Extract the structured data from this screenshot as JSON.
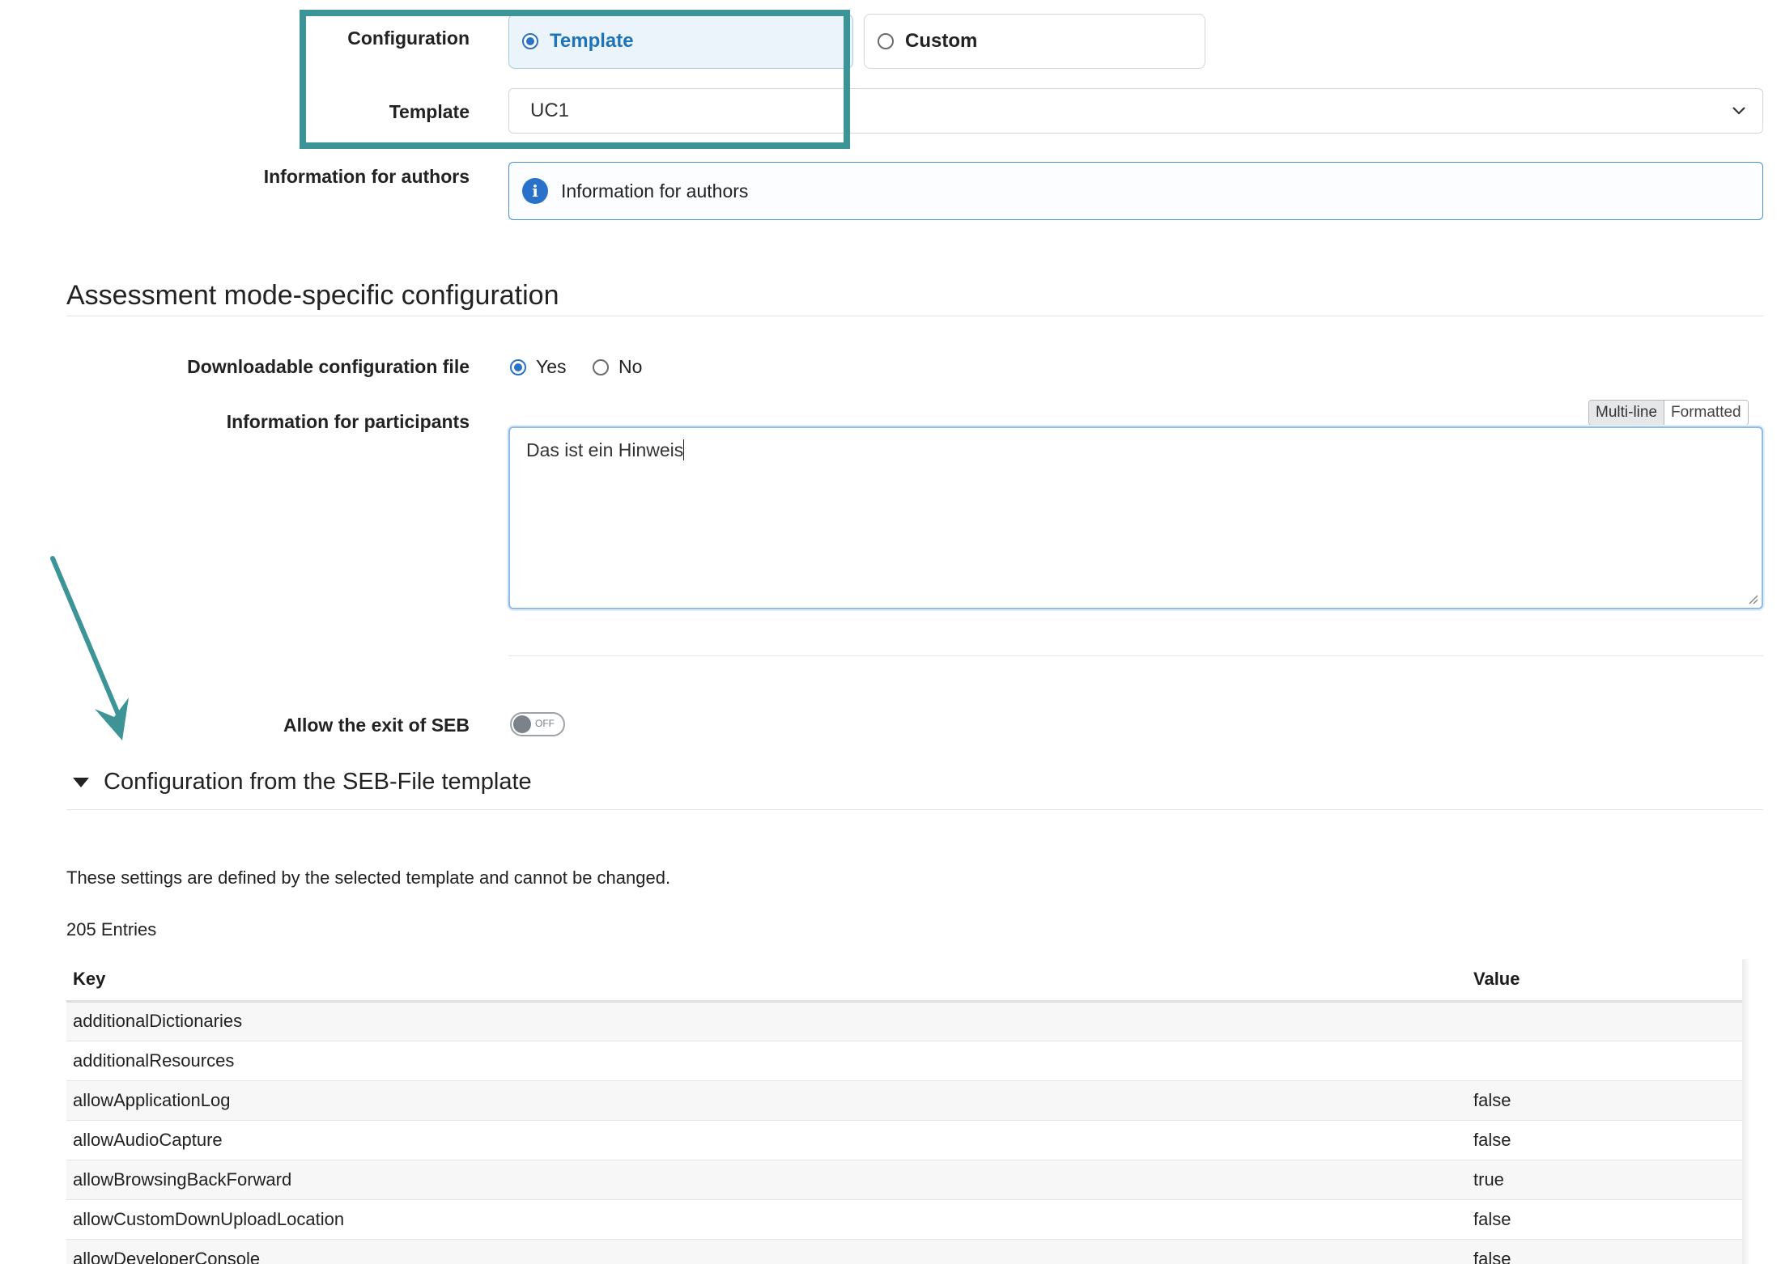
{
  "config": {
    "label": "Configuration",
    "option_template": "Template",
    "option_custom": "Custom",
    "selected": "Template"
  },
  "template": {
    "label": "Template",
    "value": "UC1"
  },
  "authors": {
    "label": "Information for authors",
    "text": "Information for authors"
  },
  "assessment": {
    "title": "Assessment mode-specific configuration",
    "download": {
      "label": "Downloadable configuration file",
      "yes": "Yes",
      "no": "No",
      "selected": "Yes"
    },
    "participants": {
      "label": "Information for participants",
      "mode_multiline": "Multi-line",
      "mode_formatted": "Formatted",
      "active_mode": "Multi-line",
      "text": "Das ist ein Hinweis"
    },
    "exit_seb": {
      "label": "Allow the exit of SEB",
      "state": "OFF"
    }
  },
  "seb_template": {
    "title": "Configuration from the SEB-File template",
    "note": "These settings are defined by the selected template and cannot be changed.",
    "entries": "205 Entries",
    "columns": {
      "key": "Key",
      "value": "Value"
    },
    "rows": [
      {
        "key": "additionalDictionaries",
        "value": ""
      },
      {
        "key": "additionalResources",
        "value": ""
      },
      {
        "key": "allowApplicationLog",
        "value": "false"
      },
      {
        "key": "allowAudioCapture",
        "value": "false"
      },
      {
        "key": "allowBrowsingBackForward",
        "value": "true"
      },
      {
        "key": "allowCustomDownUploadLocation",
        "value": "false"
      },
      {
        "key": "allowDeveloperConsole",
        "value": "false"
      }
    ]
  },
  "colors": {
    "highlight": "#3d9497",
    "accent": "#2a72c9",
    "selected_bg": "#eaf4fa"
  }
}
